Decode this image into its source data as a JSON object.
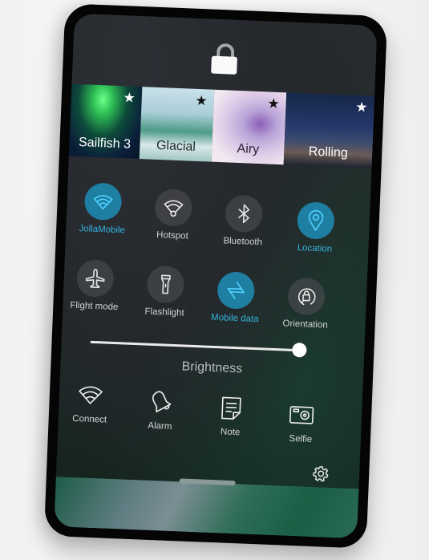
{
  "lock": {
    "icon": "lock-icon"
  },
  "ambiences": [
    {
      "name": "Sailfish 3",
      "favorite": true
    },
    {
      "name": "Glacial",
      "favorite": true
    },
    {
      "name": "Airy",
      "favorite": true
    },
    {
      "name": "Rolling",
      "favorite": true
    }
  ],
  "star_glyph": "★",
  "toggles": [
    {
      "label": "JollaMobile",
      "icon": "wifi-icon",
      "active": true
    },
    {
      "label": "Hotspot",
      "icon": "hotspot-icon",
      "active": false
    },
    {
      "label": "Bluetooth",
      "icon": "bluetooth-icon",
      "active": false
    },
    {
      "label": "Location",
      "icon": "location-icon",
      "active": true
    },
    {
      "label": "Flight mode",
      "icon": "airplane-icon",
      "active": false
    },
    {
      "label": "Flashlight",
      "icon": "flashlight-icon",
      "active": false
    },
    {
      "label": "Mobile data",
      "icon": "mobile-data-icon",
      "active": true
    },
    {
      "label": "Orientation",
      "icon": "orientation-lock-icon",
      "active": false
    }
  ],
  "brightness": {
    "label": "Brightness",
    "value_percent": 100
  },
  "shortcuts": [
    {
      "label": "Connect",
      "icon": "wifi-icon"
    },
    {
      "label": "Alarm",
      "icon": "alarm-bell-icon"
    },
    {
      "label": "Note",
      "icon": "note-icon"
    },
    {
      "label": "Selfie",
      "icon": "camera-icon"
    }
  ],
  "settings": {
    "icon": "gear-icon"
  },
  "colors": {
    "accent": "#1f7fa3",
    "accent_text": "#37b3e0"
  }
}
